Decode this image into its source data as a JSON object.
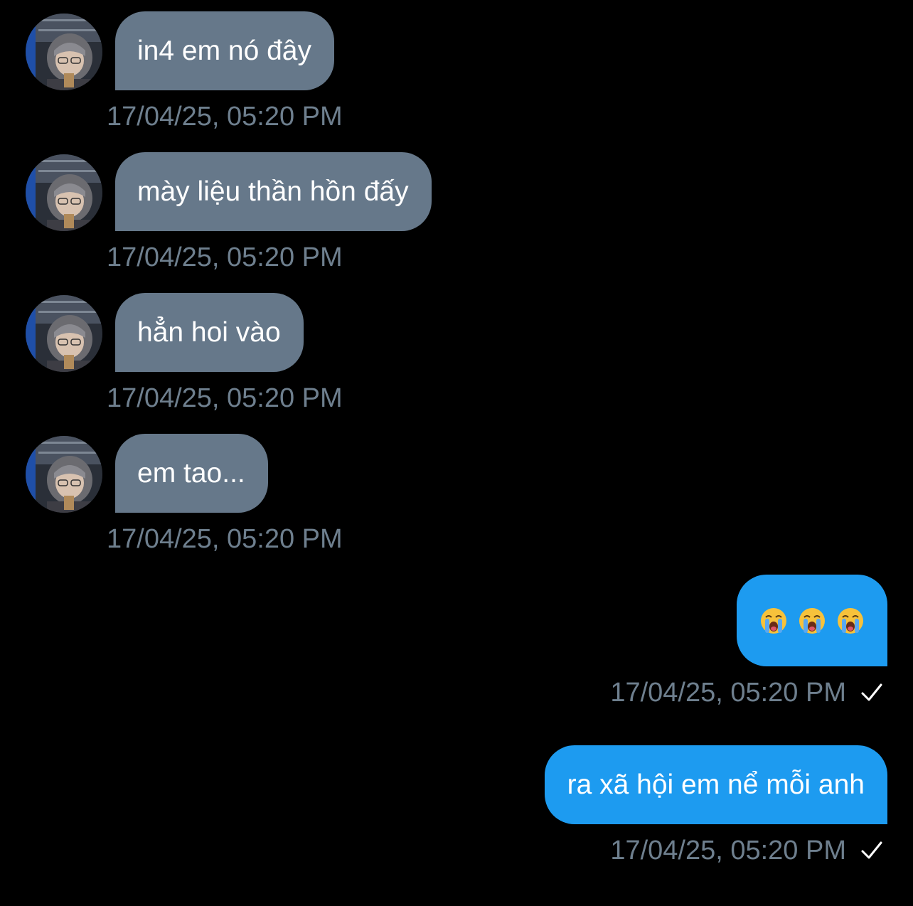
{
  "messages": [
    {
      "direction": "in",
      "text": "in4 em nó đây",
      "timestamp": "17/04/25, 05:20 PM"
    },
    {
      "direction": "in",
      "text": "mày liệu thần hồn đấy",
      "timestamp": "17/04/25, 05:20 PM"
    },
    {
      "direction": "in",
      "text": "hẳn hoi vào",
      "timestamp": "17/04/25, 05:20 PM"
    },
    {
      "direction": "in",
      "text": "em tao...",
      "timestamp": "17/04/25, 05:20 PM"
    },
    {
      "direction": "out",
      "emojis": [
        "loudly-crying-face",
        "loudly-crying-face",
        "loudly-crying-face"
      ],
      "timestamp": "17/04/25, 05:20 PM",
      "status_icon": "checkmark-icon"
    },
    {
      "direction": "out",
      "text": "ra xã hội em nể mỗi anh",
      "timestamp": "17/04/25, 05:20 PM",
      "status_icon": "checkmark-icon"
    }
  ],
  "colors": {
    "background": "#000000",
    "incoming_bubble": "#66788a",
    "outgoing_bubble": "#1d9bf0",
    "timestamp": "#6e7f8e",
    "text": "#ffffff"
  }
}
